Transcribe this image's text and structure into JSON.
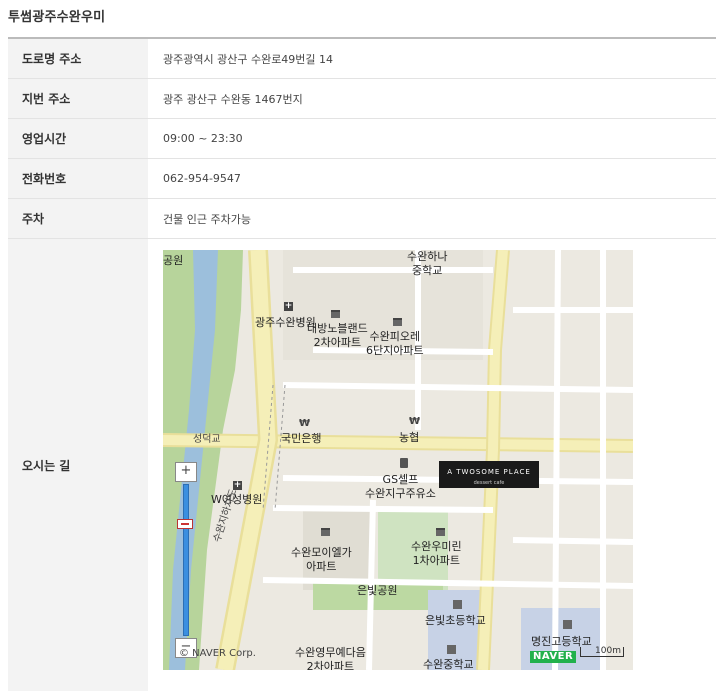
{
  "title": "투썸광주수완우미",
  "rows": [
    {
      "label": "도로명 주소",
      "value": "광주광역시 광산구 수완로49번길 14"
    },
    {
      "label": "지번 주소",
      "value": "광주 광산구 수완동 1467번지"
    },
    {
      "label": "영업시간",
      "value": "09:00 ~ 23:30"
    },
    {
      "label": "전화번호",
      "value": "062-954-9547"
    },
    {
      "label": "주차",
      "value": "건물 인근 주차가능"
    },
    {
      "label": "오시는 길",
      "value": ""
    }
  ],
  "map": {
    "zoom_in": "+",
    "zoom_out": "−",
    "cafe_name": "A TWOSOME PLACE",
    "cafe_sub": "dessert cafe",
    "copyright": "© NAVER Corp.",
    "brand": "NAVER",
    "scale": "100m",
    "labels": {
      "park_top": "공원",
      "school1": "수완하나\n중학교",
      "hospital": "광주수완병원",
      "apt1": "대방노블랜드\n2차아파트",
      "apt2": "수완피오레\n6단지아파트",
      "bridge": "성덕교",
      "bank1": "국민은행",
      "bank2": "농협",
      "gas": "GS셀프\n수완지구주유소",
      "hospital2": "W여성병원",
      "road": "수완지하차도",
      "apt3": "수완모이엘가\n아파트",
      "apt4": "수완우미린\n1차아파트",
      "park": "은빛공원",
      "school2": "은빛초등학교",
      "school3": "명진고등학교",
      "apt5": "수완영무예다음\n2차아파트",
      "school4": "수완중학교"
    }
  }
}
